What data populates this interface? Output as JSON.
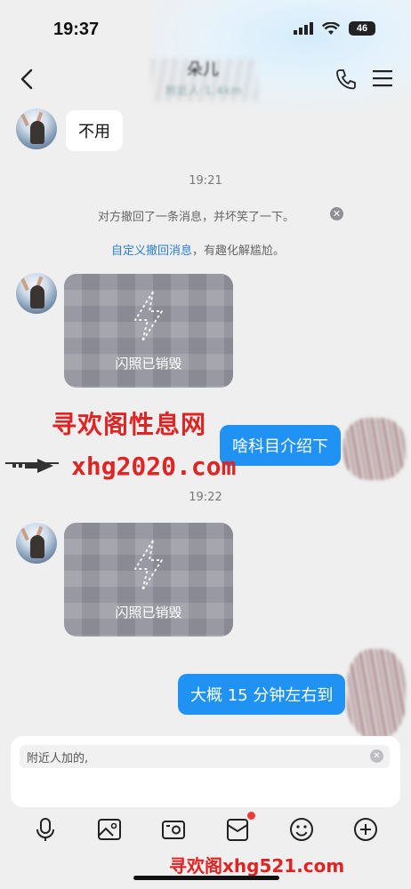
{
  "status_bar": {
    "time": "19:37",
    "battery": "46"
  },
  "header": {
    "title": "朵儿",
    "subtitle": "附近人·1.4km",
    "back_icon": "chevron-left-icon",
    "call_icon": "phone-icon",
    "menu_icon": "menu-icon"
  },
  "messages": {
    "m1_text": "不用",
    "time1": "19:21",
    "recall_notice": "对方撤回了一条消息，并坏笑了一下。",
    "recall_custom_link": "自定义撤回消息",
    "recall_custom_suffix": "，有趣化解尴尬。",
    "flash1_label": "闪照已销毁",
    "out1_text": "啥科目介绍下",
    "time2": "19:22",
    "flash2_label": "闪照已销毁",
    "out2_text": "大概 15 分钟左右到"
  },
  "watermarks": {
    "wm1": "寻欢阁性息网",
    "wm2": "xhg2020.com",
    "wm3": "寻欢阁xhg521.com"
  },
  "input": {
    "value": "附近人加的,"
  },
  "toolbar": {
    "icons": [
      "microphone-icon",
      "image-icon",
      "camera-icon",
      "red-packet-icon",
      "emoji-icon",
      "plus-icon"
    ]
  },
  "colors": {
    "accent": "#1f92f4",
    "badge": "#f23a32",
    "watermark": "#e02323"
  }
}
